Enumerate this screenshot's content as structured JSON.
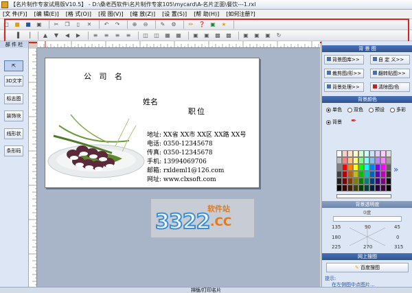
{
  "window": {
    "title": "【名片制作专家试用版V10.5】 - D:\\桑老西软件\\名片制作专家105\\mycard\\A-名片正面\\餐饮---1.rxl"
  },
  "menu": [
    "[文 件(F)]",
    "[编 辑(E)]",
    "[格 式(O)]",
    "[视 图(V)]",
    "[缩 放(Z)]",
    "[设 置(S)]",
    "[帮 助(H)]",
    "[如何注册?]"
  ],
  "left_panel": {
    "title": "部 件 栏",
    "buttons": [
      "3D文字",
      "标志图",
      "装饰块",
      "线形状",
      "条形码"
    ]
  },
  "card": {
    "company": "公 司 名",
    "name": "姓名",
    "job_title": "职位",
    "address": "地址: XX省 XX市 XX区 XX路 XX号",
    "phone": "电话: 0350-12345678",
    "fax": "传真: 0350-12345678",
    "mobile": "手机: 13994069706",
    "email": "邮箱: rxldeml1@126.com",
    "website": "网址: www.clxsoft.com"
  },
  "watermark": {
    "number": "3322",
    "suffix": ".CC",
    "site_label": "软件站"
  },
  "right_panel": {
    "bg_image_header": "背 景 图",
    "bg_library": "背景图库>>",
    "custom_bg": "自 定 义>>",
    "crop_bg": "裁剪图/形>>",
    "flip_bg": "翻转贴图>>",
    "bg_process": "背景处理>>",
    "clear_bg": "清除图/色",
    "bg_color_header": "背景颜色",
    "color_modes": [
      "单色",
      "双色",
      "预设",
      "多彩"
    ],
    "bg_label": "背景",
    "transparency_header": "背景透明度",
    "transparency_value": "0度",
    "angles_top": [
      "135",
      "90",
      "45"
    ],
    "angles_mid": [
      "180",
      "0"
    ],
    "angles_bottom": [
      "225",
      "270",
      "315"
    ],
    "online_header": "网上搜图",
    "baidu_button": "百度搜图",
    "tip_label": "提示:",
    "tip_text": "在左侧图中点图片..."
  },
  "statusbar": {
    "text": "排版/打印名片"
  },
  "colors": {
    "highlight_red": "#e02020",
    "panel_header": "#2f548f",
    "canvas_bg": "#a8b4c8"
  }
}
